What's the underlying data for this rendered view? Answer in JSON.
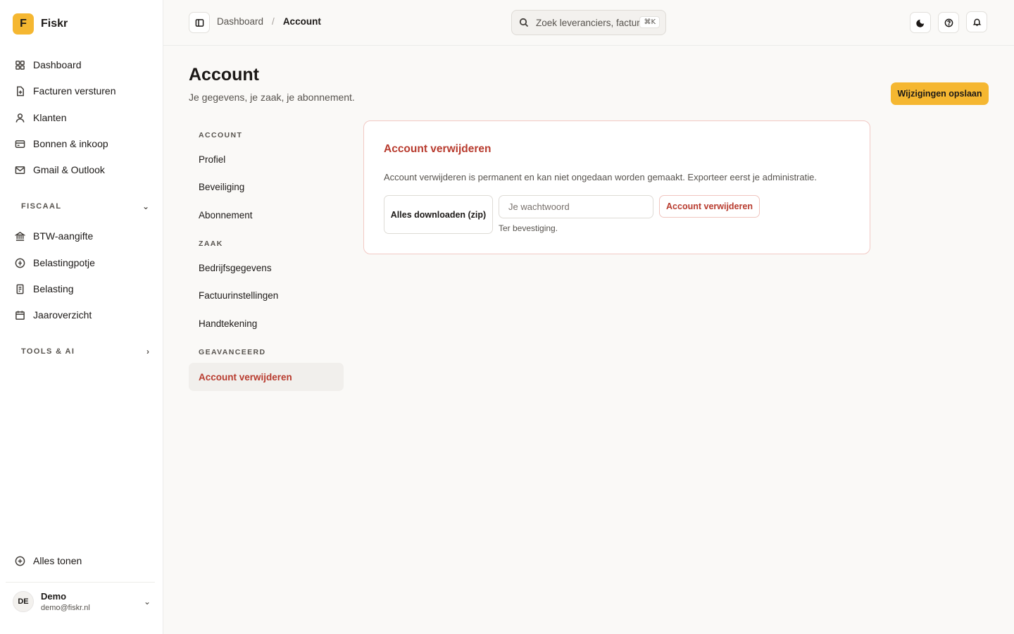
{
  "app": {
    "name": "Fiskr",
    "logo_letter": "F"
  },
  "sidebar": {
    "items": [
      {
        "label": "Dashboard",
        "icon": "grid-icon"
      },
      {
        "label": "Facturen versturen",
        "icon": "file-plus-icon"
      },
      {
        "label": "Klanten",
        "icon": "user-icon"
      },
      {
        "label": "Bonnen & inkoop",
        "icon": "card-icon"
      },
      {
        "label": "Gmail & Outlook",
        "icon": "mail-icon"
      }
    ],
    "fiscaal": {
      "heading": "FISCAAL",
      "items": [
        {
          "label": "BTW-aangifte",
          "icon": "bank-icon"
        },
        {
          "label": "Belastingpotje",
          "icon": "coin-icon"
        },
        {
          "label": "Belasting",
          "icon": "receipt-icon"
        },
        {
          "label": "Jaaroverzicht",
          "icon": "calendar-icon"
        }
      ]
    },
    "tools": {
      "heading": "TOOLS & AI"
    },
    "show_all": "Alles tonen",
    "user": {
      "initials": "DE",
      "name": "Demo",
      "email": "demo@fiskr.nl"
    }
  },
  "topbar": {
    "breadcrumb": {
      "parent": "Dashboard",
      "separator": "/",
      "current": "Account"
    },
    "search": {
      "placeholder": "Zoek leveranciers, facturen…",
      "shortcut": "⌘K"
    }
  },
  "page": {
    "title": "Account",
    "subtitle": "Je gegevens, je zaak, je abonnement.",
    "save_label": "Wijzigingen opslaan"
  },
  "settings_nav": {
    "account_heading": "ACCOUNT",
    "account_items": [
      "Profiel",
      "Beveiliging",
      "Abonnement"
    ],
    "zaak_heading": "ZAAK",
    "zaak_items": [
      "Bedrijfsgegevens",
      "Factuurinstellingen",
      "Handtekening"
    ],
    "advanced_heading": "GEAVANCEERD",
    "advanced_active": "Account verwijderen"
  },
  "delete_card": {
    "title": "Account verwijderen",
    "description": "Account verwijderen is permanent en kan niet ongedaan worden gemaakt. Exporteer eerst je administratie.",
    "download_label": "Alles downloaden (zip)",
    "password_placeholder": "Je wachtwoord",
    "password_help": "Ter bevestiging.",
    "delete_label": "Account verwijderen"
  },
  "colors": {
    "accent": "#f5b731",
    "danger": "#b83b2e",
    "background": "#faf9f7"
  }
}
